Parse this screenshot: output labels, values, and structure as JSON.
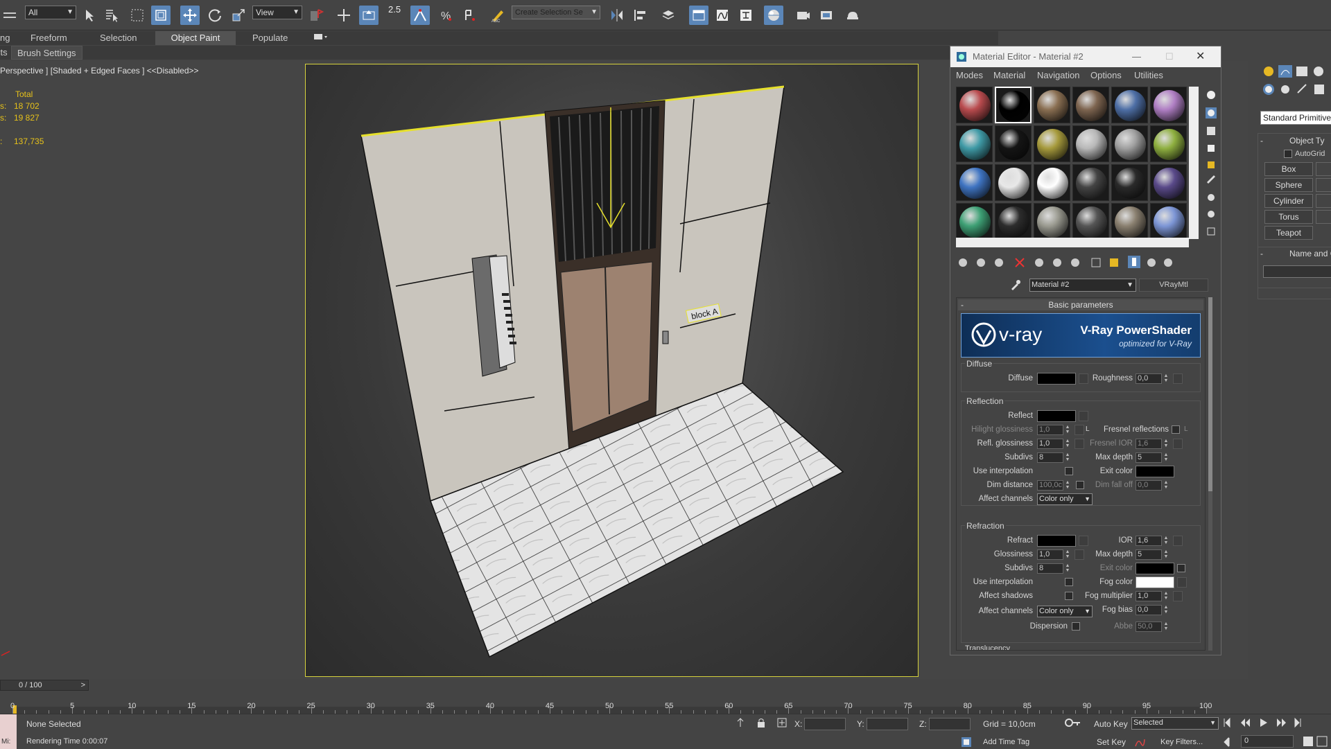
{
  "toolbar": {
    "selection_filter": "All",
    "ref_coord": "View",
    "snap_value": "2.5",
    "named_selection_placeholder": "Create Selection Se"
  },
  "ribbon": {
    "tabs": [
      "ng",
      "Freeform",
      "Selection",
      "Object Paint",
      "Populate"
    ],
    "active_tab": "Object Paint",
    "subtabs": [
      "cts",
      "Brush Settings"
    ]
  },
  "viewport": {
    "label": "Perspective ] [Shaded + Edged Faces ]  <<Disabled>>",
    "stats_total_label": "Total",
    "stats_rows": [
      {
        "key": "s:",
        "value": "18 702"
      },
      {
        "key": "s:",
        "value": "19 827"
      },
      {
        "key": ":",
        "value": "137,735"
      }
    ],
    "sign_text": "block A"
  },
  "material_editor": {
    "title": "Material Editor - Material #2",
    "menus": [
      "Modes",
      "Material",
      "Navigation",
      "Options",
      "Utilities"
    ],
    "material_name": "Material #2",
    "material_type": "VRayMtl",
    "rollout_title": "Basic parameters",
    "banner_logo": "v-ray",
    "banner_title": "V-Ray PowerShader",
    "banner_sub": "optimized for V-Ray",
    "diffuse": {
      "group": "Diffuse",
      "label": "Diffuse",
      "roughness_label": "Roughness",
      "roughness": "0,0"
    },
    "reflection": {
      "group": "Reflection",
      "reflect_label": "Reflect",
      "hilight_label": "Hilight glossiness",
      "hilight": "1,0",
      "refl_gloss_label": "Refl. glossiness",
      "refl_gloss": "1,0",
      "subdivs_label": "Subdivs",
      "subdivs": "8",
      "use_interp_label": "Use interpolation",
      "dim_distance_label": "Dim distance",
      "dim_distance": "100,0c",
      "affect_label": "Affect channels",
      "affect": "Color only",
      "fresnel_label": "Fresnel reflections",
      "fresnel_ior_label": "Fresnel IOR",
      "fresnel_ior": "1,6",
      "max_depth_label": "Max depth",
      "max_depth": "5",
      "exit_color_label": "Exit color",
      "dim_falloff_label": "Dim fall off",
      "dim_falloff": "0,0",
      "lock_letter": "L"
    },
    "refraction": {
      "group": "Refraction",
      "refract_label": "Refract",
      "gloss_label": "Glossiness",
      "gloss": "1,0",
      "subdivs_label": "Subdivs",
      "subdivs": "8",
      "use_interp_label": "Use interpolation",
      "affect_shadows_label": "Affect shadows",
      "affect_label": "Affect channels",
      "affect": "Color only",
      "dispersion_label": "Dispersion",
      "ior_label": "IOR",
      "ior": "1,6",
      "max_depth_label": "Max depth",
      "max_depth": "5",
      "exit_color_label": "Exit color",
      "fog_color_label": "Fog color",
      "fog_mult_label": "Fog multiplier",
      "fog_mult": "1,0",
      "fog_bias_label": "Fog bias",
      "fog_bias": "0,0",
      "abbe_label": "Abbe",
      "abbe": "50,0"
    },
    "next_group": "Translucency",
    "slot_colors": [
      [
        "#b94b4e",
        "#000000",
        "#8a6f52",
        "#7e6550",
        "#4e6fa6",
        "#b07fc4"
      ],
      [
        "#3f9aa6",
        "#151515",
        "#a69a3c",
        "#b8b8b8",
        "#a0a0a0",
        "#8fb040"
      ],
      [
        "#3f74c2",
        "#e8e8e8",
        "#ffffff",
        "#444444",
        "#2a2a2a",
        "#5a4a8a"
      ],
      [
        "#3ea075",
        "#2d2d2d",
        "#9a9a90",
        "#555555",
        "#8a8070",
        "#7d96d6"
      ]
    ]
  },
  "command_panel": {
    "dropdown": "Standard Primitives",
    "object_type_label": "Object Ty",
    "autogrid": "AutoGrid",
    "buttons": [
      "Box",
      "Sphere",
      "Cylinder",
      "Torus",
      "Teapot"
    ],
    "name_color_label": "Name and C"
  },
  "timeline": {
    "frame": "0 / 100",
    "ticks": [
      0,
      5,
      10,
      15,
      20,
      25,
      30,
      35,
      40,
      45,
      50,
      55,
      60,
      65,
      70,
      75,
      80,
      85,
      90,
      95,
      100
    ]
  },
  "status": {
    "selection": "None Selected",
    "rendering": "Rendering Time  0:00:07",
    "x_label": "X:",
    "y_label": "Y:",
    "z_label": "Z:",
    "grid": "Grid = 10,0cm",
    "add_time_tag": "Add Time Tag",
    "auto_key": "Auto Key",
    "set_key": "Set Key",
    "key_mode": "Selected",
    "key_filters": "Key Filters...",
    "frame_field": "0",
    "maxscript": "Mi:"
  }
}
